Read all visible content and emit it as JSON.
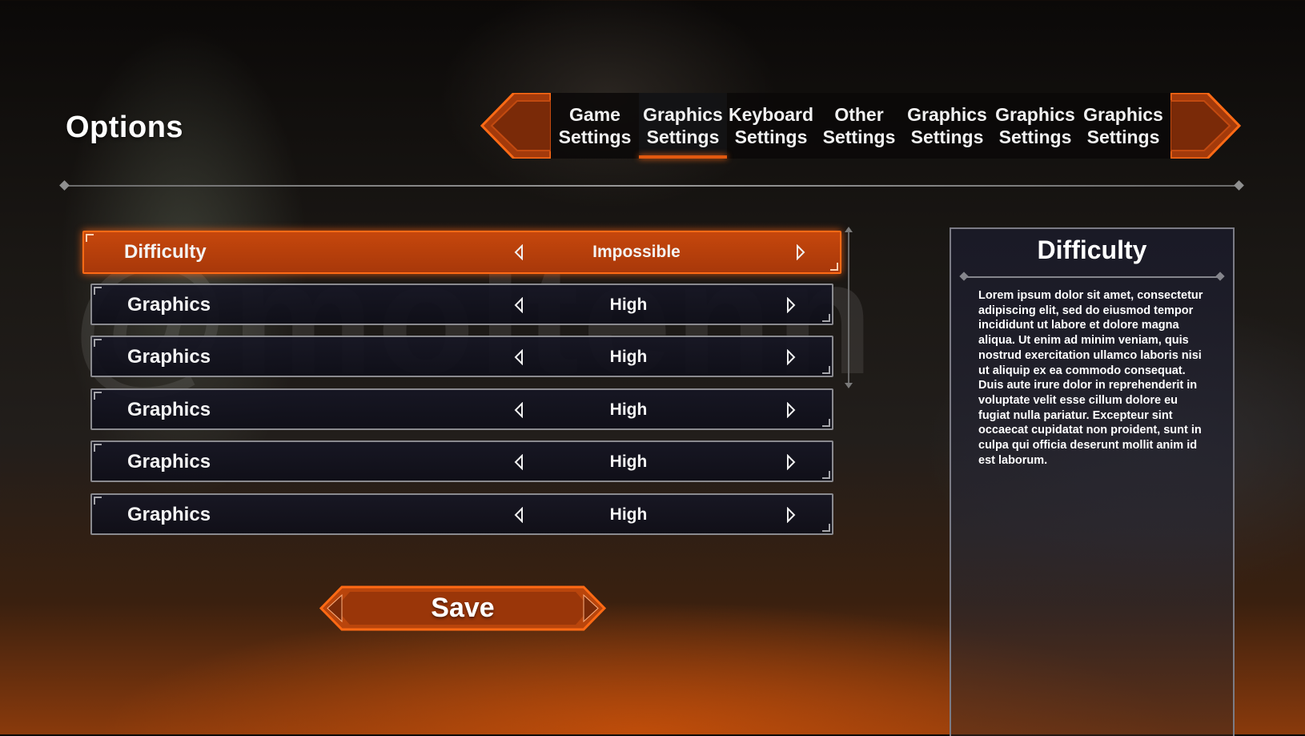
{
  "screen": {
    "title": "Options"
  },
  "tabs": [
    {
      "label": "Game\nSettings",
      "active": false
    },
    {
      "label": "Graphics\nSettings",
      "active": true
    },
    {
      "label": "Keyboard\nSettings",
      "active": false
    },
    {
      "label": "Other\nSettings",
      "active": false
    },
    {
      "label": "Graphics\nSettings",
      "active": false
    },
    {
      "label": "Graphics\nSettings",
      "active": false
    },
    {
      "label": "Graphics\nSettings",
      "active": false
    }
  ],
  "settings": [
    {
      "label": "Difficulty",
      "value": "Impossible",
      "active": true
    },
    {
      "label": "Graphics",
      "value": "High",
      "active": false
    },
    {
      "label": "Graphics",
      "value": "High",
      "active": false
    },
    {
      "label": "Graphics",
      "value": "High",
      "active": false
    },
    {
      "label": "Graphics",
      "value": "High",
      "active": false
    },
    {
      "label": "Graphics",
      "value": "High",
      "active": false
    }
  ],
  "save_button": {
    "label": "Save"
  },
  "description": {
    "title": "Difficulty",
    "body": "Lorem ipsum dolor sit amet, consectetur adipiscing elit, sed do eiusmod tempor incididunt ut labore et dolore magna aliqua. Ut enim ad minim veniam, quis nostrud exercitation ullamco laboris nisi ut aliquip ex ea commodo consequat. Duis aute irure dolor in reprehenderit in voluptate velit esse cillum dolore eu fugiat nulla pariatur. Excepteur sint occaecat cupidatat non proident, sunt in culpa qui officia deserunt mollit anim id est laborum."
  },
  "watermark": {
    "text": "@moltenn"
  },
  "colors": {
    "accent": "#e2590f",
    "accent_glow": "#ff6a15",
    "row_bg": "#16162a",
    "border": "#8a8a8f"
  },
  "icons": {
    "tab_prev": "chevron-left-icon",
    "tab_next": "chevron-right-icon",
    "value_prev": "triangle-left-icon",
    "value_next": "triangle-right-icon"
  }
}
